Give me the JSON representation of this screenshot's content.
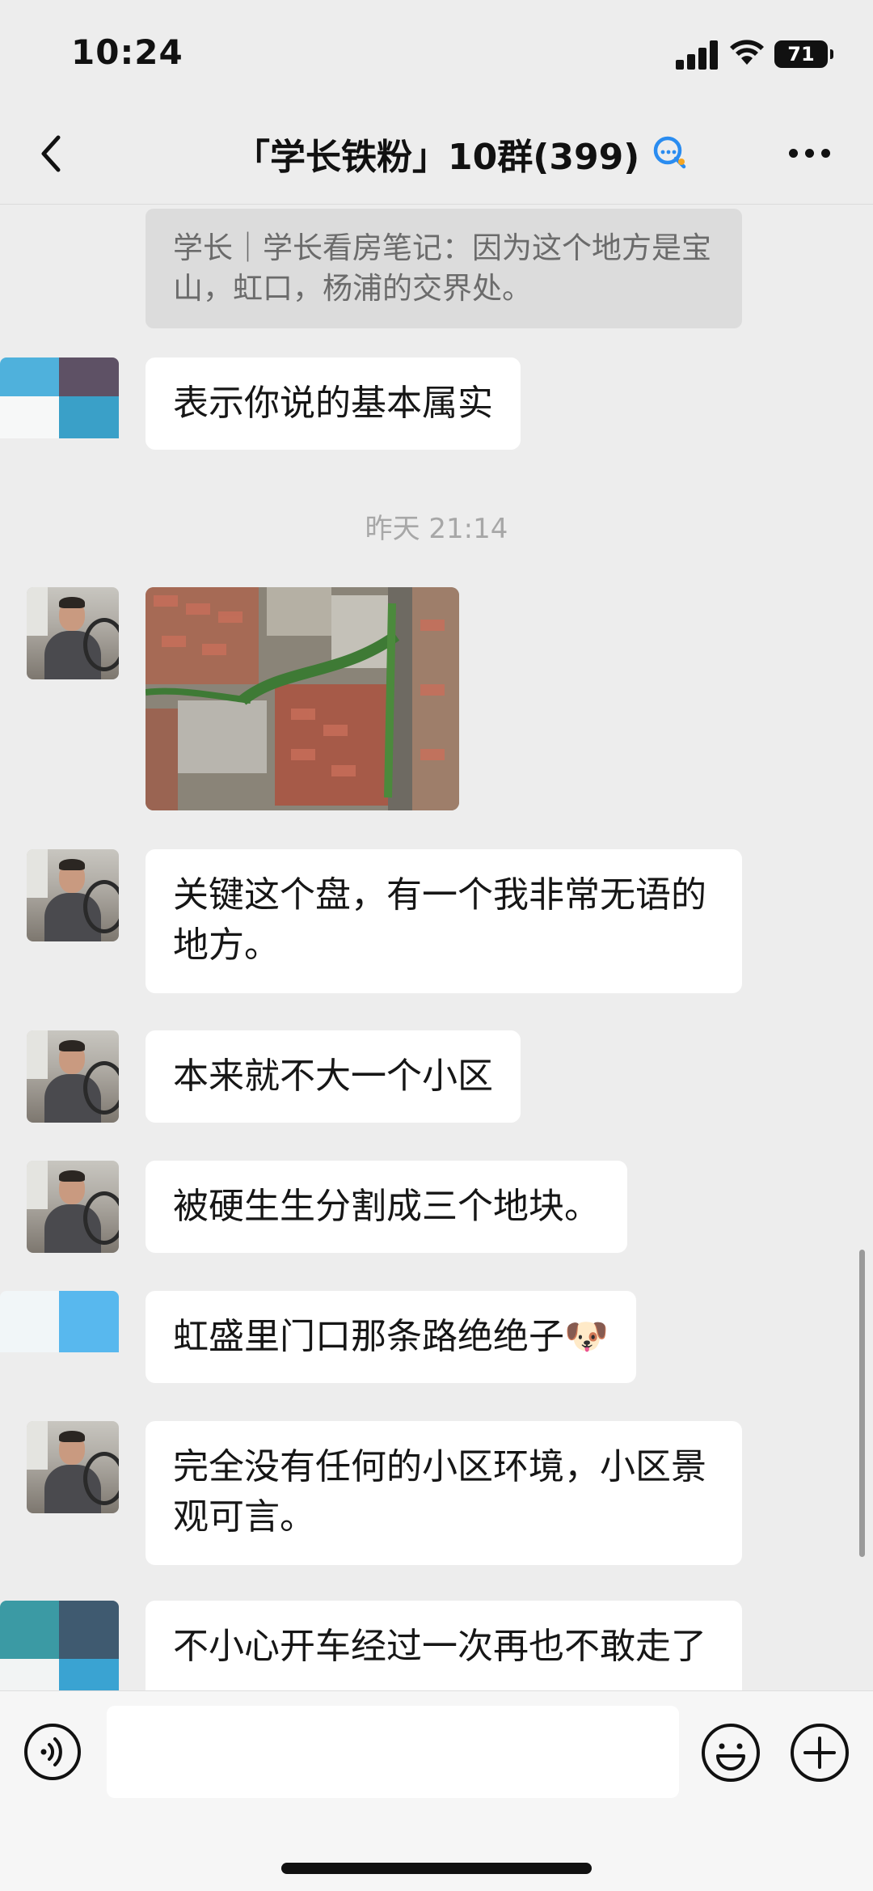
{
  "status_bar": {
    "time": "10:24",
    "battery": "71"
  },
  "nav": {
    "title": "「学长铁粉」10群(399)"
  },
  "quote": {
    "text": "学长｜学长看房笔记：因为这个地方是宝山，虹口，杨浦的交界处。"
  },
  "messages": [
    {
      "text": "表示你说的基本属实"
    },
    {
      "timestamp": "昨天 21:14"
    },
    {
      "image": "aerial-map-photo"
    },
    {
      "text": "关键这个盘，有一个我非常无语的地方。"
    },
    {
      "text": "本来就不大一个小区"
    },
    {
      "text": "被硬生生分割成三个地块。"
    },
    {
      "text": "虹盛里门口那条路绝绝子",
      "emoji": "🐶"
    },
    {
      "text": "完全没有任何的小区环境，小区景观可言。"
    },
    {
      "text": "不小心开车经过一次再也不敢走了"
    }
  ],
  "input": {
    "placeholder": ""
  },
  "colors": {
    "background": "#ededed",
    "bubble": "#ffffff",
    "accent": "#2a8cf0"
  }
}
